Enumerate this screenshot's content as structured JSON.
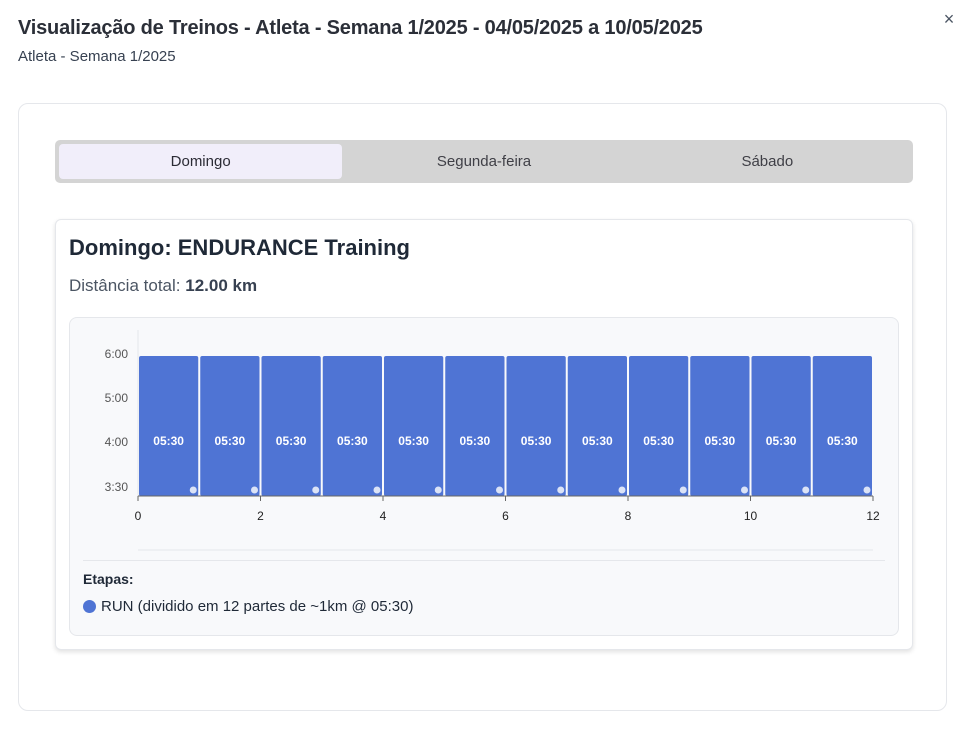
{
  "header": {
    "title": "Visualização de Treinos - Atleta - Semana 1/2025 - 04/05/2025 a 10/05/2025",
    "subtitle": "Atleta - Semana 1/2025",
    "close_icon": "×"
  },
  "tabs": [
    {
      "label": "Domingo",
      "active": true
    },
    {
      "label": "Segunda-feira",
      "active": false
    },
    {
      "label": "Sábado",
      "active": false
    }
  ],
  "day": {
    "title": "Domingo: ENDURANCE Training",
    "distance_label": "Distância total:",
    "distance_value": "12.00 km"
  },
  "legend": {
    "title": "Etapas:",
    "items": [
      {
        "label": "RUN (dividido em 12 partes de ~1km @ 05:30)",
        "color": "#4f74d4"
      }
    ]
  },
  "colors": {
    "bar": "#4f74d4",
    "bar_marker": "#dbe3f6",
    "axis": "#666666"
  },
  "chart_data": {
    "type": "bar",
    "x": [
      0.5,
      1.5,
      2.5,
      3.5,
      4.5,
      5.5,
      6.5,
      7.5,
      8.5,
      9.5,
      10.5,
      11.5
    ],
    "bar_width": 1,
    "values": [
      5.5,
      5.5,
      5.5,
      5.5,
      5.5,
      5.5,
      5.5,
      5.5,
      5.5,
      5.5,
      5.5,
      5.5
    ],
    "bar_labels": [
      "05:30",
      "05:30",
      "05:30",
      "05:30",
      "05:30",
      "05:30",
      "05:30",
      "05:30",
      "05:30",
      "05:30",
      "05:30",
      "05:30"
    ],
    "xlim": [
      0,
      12
    ],
    "xticks": [
      0,
      2,
      4,
      6,
      8,
      10,
      12
    ],
    "xtick_labels": [
      "0",
      "2",
      "4",
      "6",
      "8",
      "10",
      "12"
    ],
    "ylim": [
      3.5,
      6.5
    ],
    "yticks": [
      3.5,
      4,
      5,
      6
    ],
    "ytick_labels": [
      "3:30",
      "4:00",
      "5:00",
      "6:00"
    ],
    "grid": false,
    "xlabel": "",
    "ylabel": ""
  }
}
